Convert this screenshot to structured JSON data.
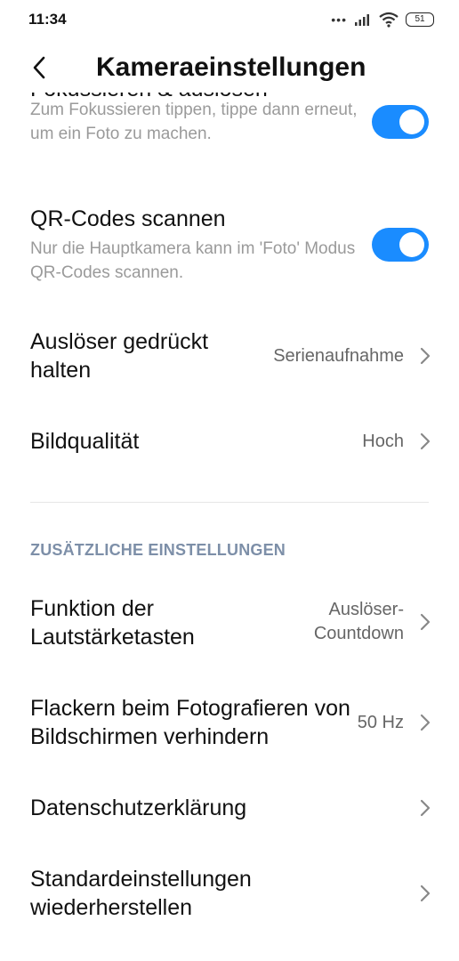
{
  "status_bar": {
    "time": "11:34",
    "signal_dots": "•••",
    "battery": "51"
  },
  "header": {
    "title": "Kameraeinstellungen"
  },
  "settings": [
    {
      "title": "Fokussieren & auslösen",
      "desc": "Zum Fokussieren tippen, tippe dann erneut, um ein Foto zu machen.",
      "toggle": "on"
    },
    {
      "title": "QR-Codes scannen",
      "desc": "Nur die Hauptkamera kann im 'Foto' Modus QR-Codes scannen.",
      "toggle": "on"
    },
    {
      "title": "Auslöser gedrückt halten",
      "value": "Serienaufnahme"
    },
    {
      "title": "Bildqualität",
      "value": "Hoch"
    }
  ],
  "section": {
    "label": "ZUSÄTZLICHE EINSTELLUNGEN"
  },
  "additional": [
    {
      "title": "Funktion der Lautstärketasten",
      "value": "Auslöser-Countdown"
    },
    {
      "title": "Flackern beim Fotografieren von Bildschirmen verhindern",
      "value": "50 Hz"
    },
    {
      "title": "Datenschutzerklärung"
    },
    {
      "title": "Standardeinstellungen wiederherstellen"
    }
  ],
  "colors": {
    "accent": "#1a8cff",
    "section": "#7d8fa8",
    "secondary_text": "#9a9a9a"
  }
}
